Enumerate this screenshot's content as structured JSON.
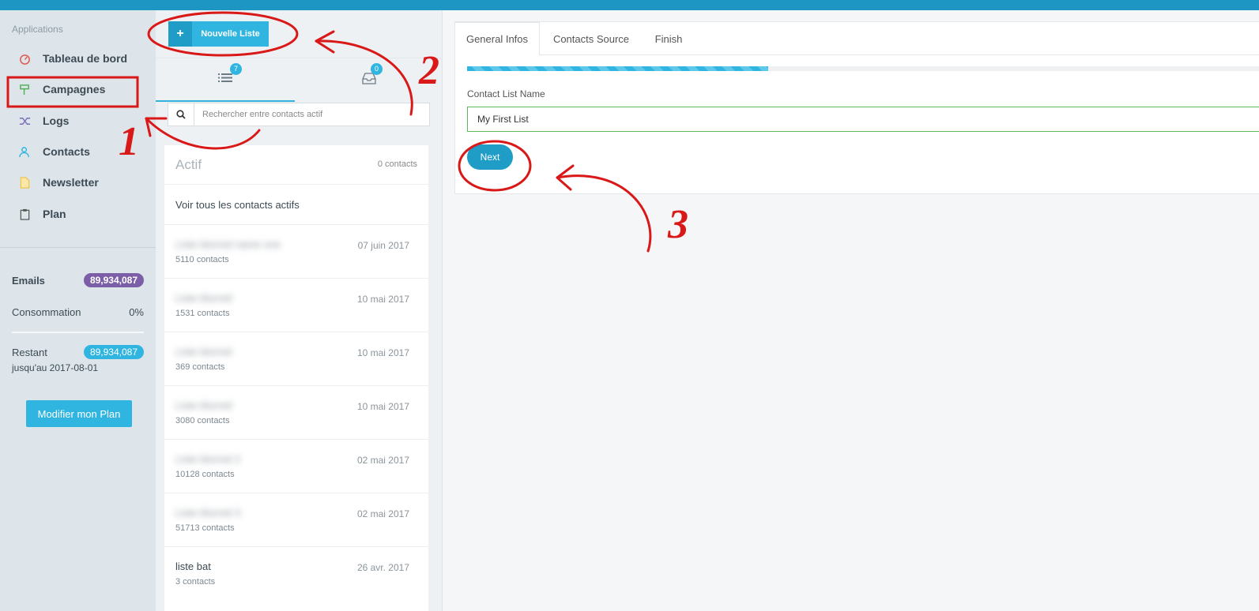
{
  "sidebar": {
    "section_title": "Applications",
    "items": [
      {
        "label": "Tableau de bord",
        "icon": "dashboard-icon",
        "color": "#e05a4e"
      },
      {
        "label": "Campagnes",
        "icon": "signpost-icon",
        "color": "#4caf50"
      },
      {
        "label": "Logs",
        "icon": "shuffle-icon",
        "color": "#7b6bbf"
      },
      {
        "label": "Contacts",
        "icon": "users-icon",
        "color": "#2fb5e0"
      },
      {
        "label": "Newsletter",
        "icon": "file-icon",
        "color": "#f0c040"
      },
      {
        "label": "Plan",
        "icon": "clipboard-icon",
        "color": "#555555"
      }
    ],
    "emails_label": "Emails",
    "emails_value": "89,934,087",
    "consumption_label": "Consommation",
    "consumption_value": "0%",
    "remaining_label": "Restant",
    "remaining_until": "jusqu'au 2017-08-01",
    "remaining_value": "89,934,087",
    "plan_button": "Modifier mon Plan"
  },
  "middle": {
    "new_list_button": "Nouvelle Liste",
    "tab_list_count": "7",
    "tab_inbox_count": "0",
    "search_placeholder": "Rechercher entre contacts actif",
    "list_title": "Actif",
    "list_count": "0 contacts",
    "view_all": "Voir tous les contacts actifs",
    "rows": [
      {
        "name": "Liste blurred name one",
        "contacts": "5110 contacts",
        "date": "07 juin 2017"
      },
      {
        "name": "Liste blurred",
        "contacts": "1531 contacts",
        "date": "10 mai 2017"
      },
      {
        "name": "Liste blurred",
        "contacts": "369 contacts",
        "date": "10 mai 2017"
      },
      {
        "name": "Liste blurred",
        "contacts": "3080 contacts",
        "date": "10 mai 2017"
      },
      {
        "name": "Liste blurred 2",
        "contacts": "10128 contacts",
        "date": "02 mai 2017"
      },
      {
        "name": "Liste blurred 3",
        "contacts": "51713 contacts",
        "date": "02 mai 2017"
      },
      {
        "name": "liste bat",
        "contacts": "3 contacts",
        "date": "26 avr. 2017"
      }
    ]
  },
  "main": {
    "tabs": [
      {
        "label": "General Infos"
      },
      {
        "label": "Contacts Source"
      },
      {
        "label": "Finish"
      }
    ],
    "progress": 0.38,
    "field_label": "Contact List Name",
    "field_value": "My First List",
    "next_button": "Next"
  },
  "annotations": {
    "n1": "1",
    "n2": "2",
    "n3": "3"
  }
}
